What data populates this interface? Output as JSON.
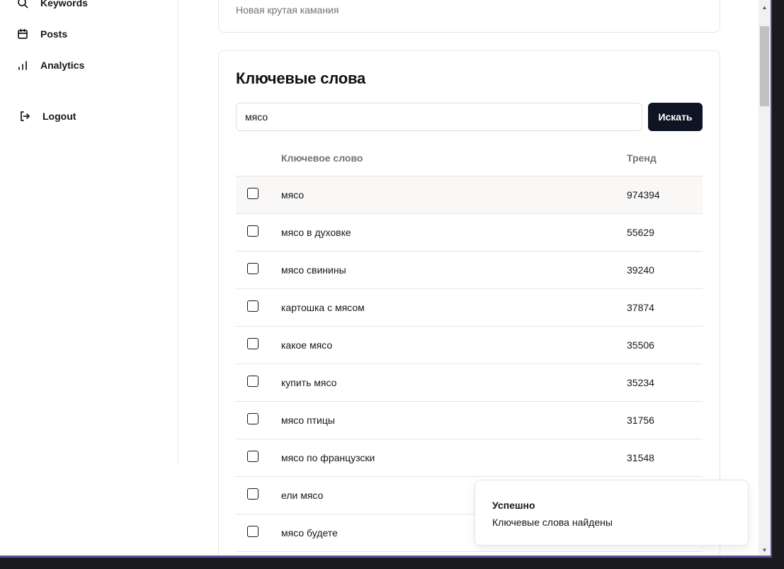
{
  "sidebar": {
    "items": [
      {
        "label": "Keywords",
        "icon": "search-icon"
      },
      {
        "label": "Posts",
        "icon": "calendar-icon"
      },
      {
        "label": "Analytics",
        "icon": "bar-chart-icon"
      }
    ],
    "logout": {
      "label": "Logout",
      "icon": "logout-icon"
    }
  },
  "campaign": {
    "subtitle": "Новая крутая камания"
  },
  "keywords_card": {
    "title": "Ключевые слова",
    "search_value": "мясо",
    "search_button": "Искать",
    "columns": {
      "keyword": "Ключевое слово",
      "trend": "Тренд"
    },
    "rows": [
      {
        "keyword": "мясо",
        "trend": "974394"
      },
      {
        "keyword": "мясо в духовке",
        "trend": "55629"
      },
      {
        "keyword": "мясо свинины",
        "trend": "39240"
      },
      {
        "keyword": "картошка с мясом",
        "trend": "37874"
      },
      {
        "keyword": "какое мясо",
        "trend": "35506"
      },
      {
        "keyword": "купить мясо",
        "trend": "35234"
      },
      {
        "keyword": "мясо птицы",
        "trend": "31756"
      },
      {
        "keyword": "мясо по французски",
        "trend": "31548"
      },
      {
        "keyword": "ели мясо",
        "trend": ""
      },
      {
        "keyword": "мясо будете",
        "trend": ""
      }
    ]
  },
  "toast": {
    "title": "Успешно",
    "message": "Ключевые слова найдены"
  },
  "colors": {
    "primary_button": "#0f1424",
    "border": "#e7e5e4",
    "muted_text": "#78716c",
    "window_border": "#5a4fa0"
  }
}
